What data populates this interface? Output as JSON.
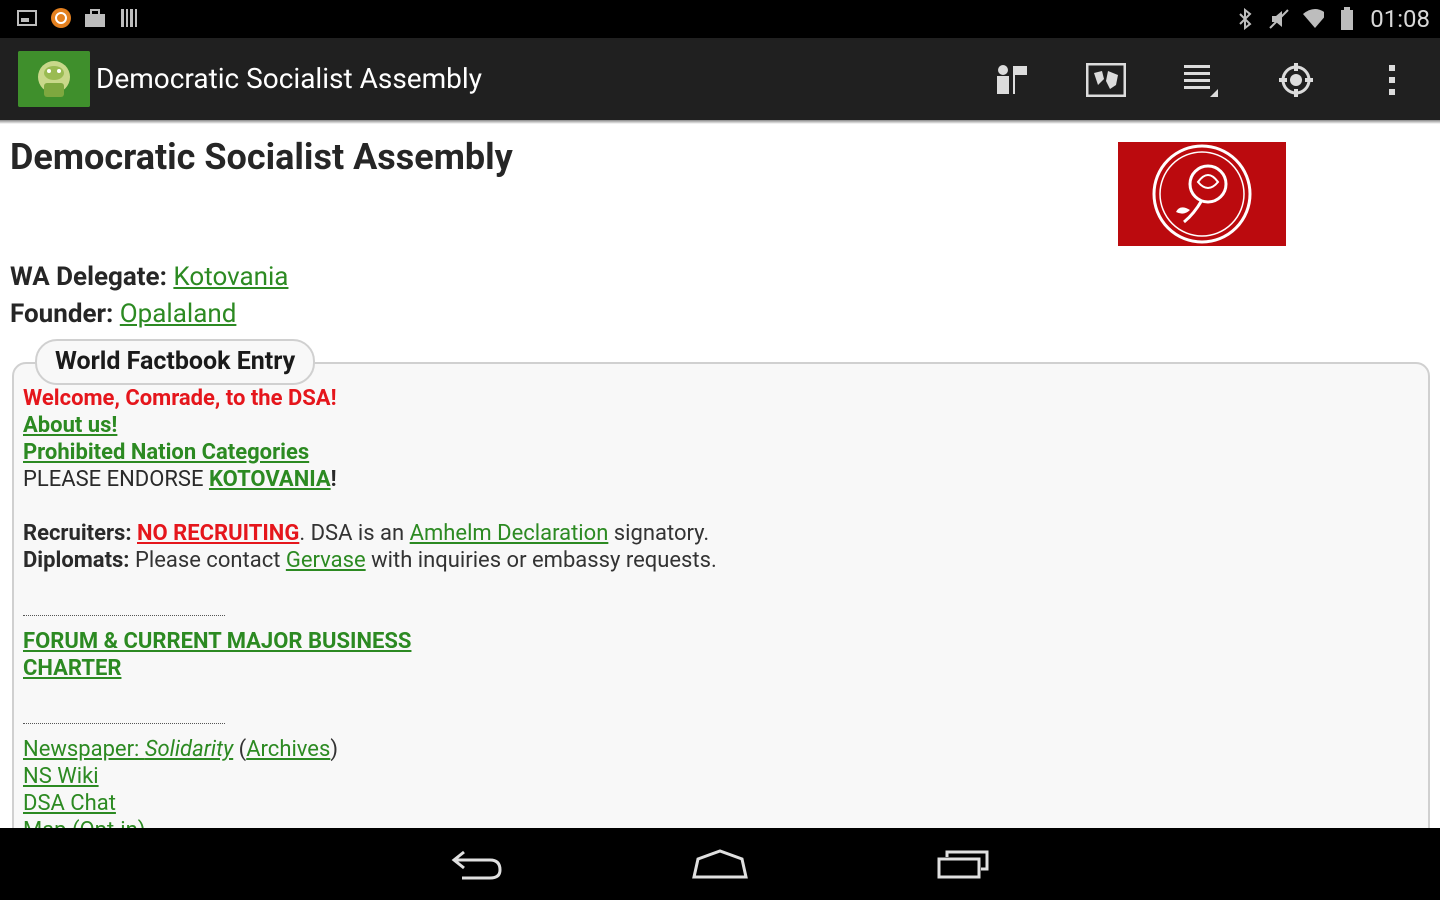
{
  "status_bar": {
    "time": "01:08",
    "notification_icons": [
      "image-icon",
      "ubuntu-icon",
      "briefcase-icon",
      "barcode-icon"
    ],
    "system_icons": [
      "bluetooth-icon",
      "mute-icon",
      "wifi-icon",
      "battery-icon"
    ]
  },
  "action_bar": {
    "title": "Democratic Socialist Assembly",
    "actions": [
      "nations-icon",
      "map-icon",
      "list-icon",
      "target-icon",
      "overflow-menu-icon"
    ]
  },
  "region": {
    "name": "Democratic Socialist Assembly",
    "flag_color": "#bb0a0e",
    "wa_delegate_label": "WA Delegate:",
    "wa_delegate": "Kotovania",
    "founder_label": "Founder:",
    "founder": "Opalaland"
  },
  "factbook": {
    "tab_label": "World Factbook Entry",
    "welcome": "Welcome, Comrade, to the DSA!",
    "about": "About us!",
    "prohibited": "Prohibited Nation Categories",
    "endorse_prefix": "PLEASE ENDORSE ",
    "endorse_link": "KOTOVANIA",
    "endorse_suffix": "!",
    "recruiters_label": "Recruiters:",
    "no_recruiting": "NO RECRUITING",
    "recruiters_mid": ". DSA is an ",
    "amhelm": "Amhelm Declaration",
    "recruiters_end": " signatory.",
    "diplomats_label": "Diplomats:",
    "diplomats_mid": " Please contact ",
    "gervase": "Gervase",
    "diplomats_end": " with inquiries or embassy requests.",
    "forum": "FORUM & CURRENT MAJOR BUSINESS",
    "charter": "CHARTER",
    "newspaper_prefix": "Newspaper: ",
    "newspaper_name": "Solidarity",
    "archives_open": " (",
    "archives": "Archives",
    "archives_close": ")",
    "ns_wiki": "NS Wiki",
    "dsa_chat": "DSA Chat",
    "map_partial": "Map (Opt-in)"
  },
  "colors": {
    "link_green": "#2c8a22",
    "alert_red": "#e5161c",
    "action_bar_bg": "#202020"
  }
}
